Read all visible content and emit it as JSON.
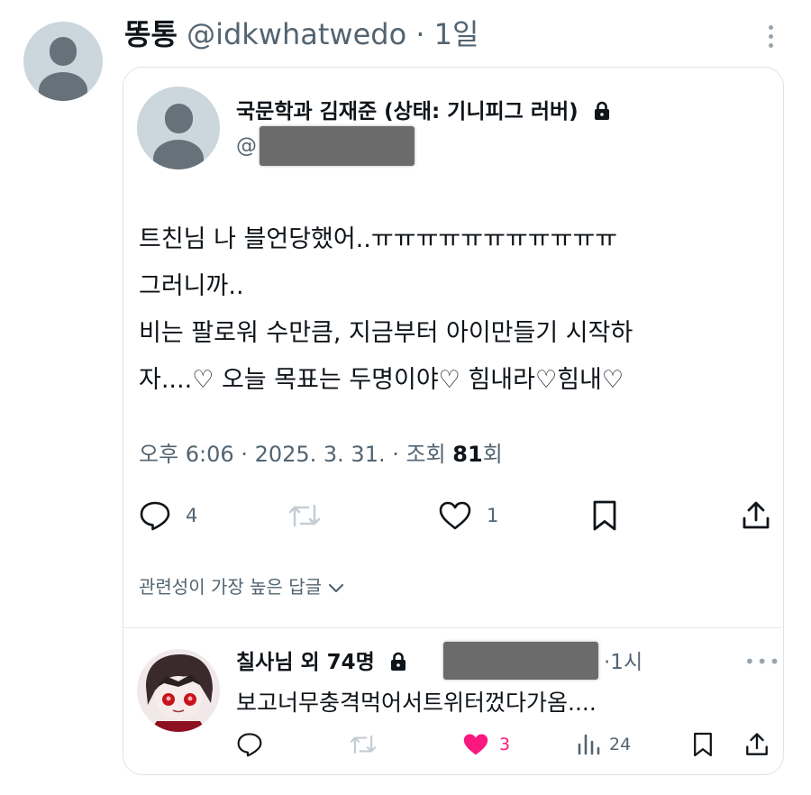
{
  "outer_tweet": {
    "display_name": "똥통",
    "handle": "@idkwhatwedo",
    "separator": "·",
    "time": "1일"
  },
  "quoted_tweet": {
    "display_name": "국문학과 김재준 (상태: 기니피그 러버)",
    "handle_prefix": "@",
    "body_lines": [
      "트친님 나 블언당했어..ㅠㅠㅠㅠㅠㅠㅠㅠㅠㅠㅠ",
      "그러니까..",
      "비는 팔로워 수만큼, 지금부터 아이만들기 시작하",
      "자....♡ 오늘 목표는 두명이야♡ 힘내라♡힘내♡"
    ],
    "meta_prefix": "오후 6:06 · 2025. 3. 31. · 조회 ",
    "views": "81",
    "meta_suffix": "회",
    "reply_count": "4",
    "like_count": "1",
    "sort_label": "관련성이 가장 높은 답글"
  },
  "reply": {
    "display_name": "칠사님 외 74명",
    "time": "·1시",
    "text": "보고너무충격먹어서트위터껐다가옴....",
    "like_count": "3",
    "view_count": "24",
    "like_color": "#f91880"
  },
  "colors": {
    "text": "#0f1419",
    "secondary": "#536471",
    "border": "#dfe3e7",
    "avatar_bg": "#ccd6dd",
    "avatar_fg": "#67717a"
  }
}
